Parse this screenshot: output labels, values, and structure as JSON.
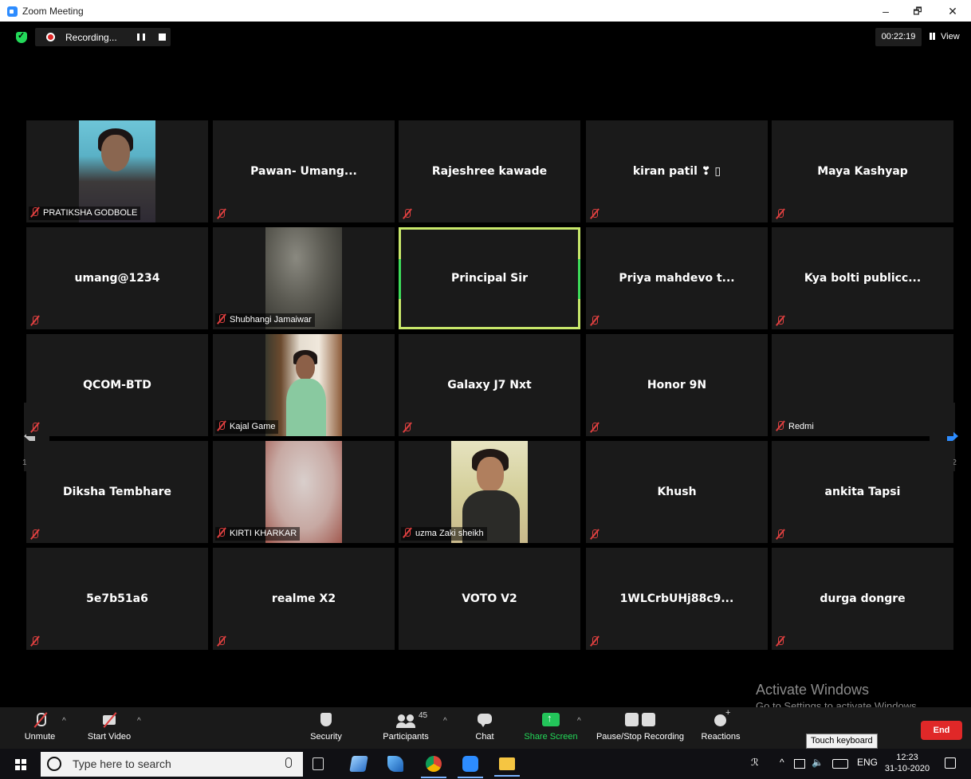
{
  "window": {
    "title": "Zoom Meeting",
    "minimize": "–",
    "restore": "🗗",
    "close": "✕"
  },
  "topbar": {
    "recording_label": "Recording...",
    "timer": "00:22:19",
    "view_label": "View"
  },
  "gallery": {
    "page_indicator_left": "1/2",
    "page_indicator_right": "1/2",
    "active_speaker": "Principal Sir",
    "tiles": [
      {
        "name": "PRATIKSHA GODBOLE",
        "video": true,
        "muted": true
      },
      {
        "name": "Pawan- Umang...",
        "video": false,
        "muted": true
      },
      {
        "name": "Rajeshree kawade",
        "video": false,
        "muted": true
      },
      {
        "name": "kiran patil ❣ ▯",
        "video": false,
        "muted": true
      },
      {
        "name": "Maya Kashyap",
        "video": false,
        "muted": true
      },
      {
        "name": "umang@1234",
        "video": false,
        "muted": true
      },
      {
        "name": "Shubhangi Jamaiwar",
        "video": true,
        "muted": true
      },
      {
        "name": "Principal Sir",
        "video": false,
        "muted": false
      },
      {
        "name": "Priya mahdevo t...",
        "video": false,
        "muted": true
      },
      {
        "name": "Kya bolti publicc...",
        "video": false,
        "muted": true
      },
      {
        "name": "QCOM-BTD",
        "video": false,
        "muted": true
      },
      {
        "name": "Kajal Game",
        "video": true,
        "muted": true
      },
      {
        "name": "Galaxy J7 Nxt",
        "video": false,
        "muted": true
      },
      {
        "name": "Honor 9N",
        "video": false,
        "muted": true
      },
      {
        "name": "Redmi",
        "video": false,
        "muted": true
      },
      {
        "name": "Diksha Tembhare",
        "video": false,
        "muted": true
      },
      {
        "name": "KIRTI KHARKAR",
        "video": true,
        "muted": true
      },
      {
        "name": "uzma Zaki sheikh",
        "video": true,
        "muted": true
      },
      {
        "name": "Khush",
        "video": false,
        "muted": true
      },
      {
        "name": "ankita Tapsi",
        "video": false,
        "muted": true
      },
      {
        "name": "5e7b51a6",
        "video": false,
        "muted": true
      },
      {
        "name": "realme X2",
        "video": false,
        "muted": true
      },
      {
        "name": "VOTO V2",
        "video": false,
        "muted": false
      },
      {
        "name": "1WLCrbUHj88c9...",
        "video": false,
        "muted": true
      },
      {
        "name": "durga dongre",
        "video": false,
        "muted": true
      }
    ]
  },
  "watermark": {
    "line1": "Activate Windows",
    "line2": "Go to Settings to activate Windows."
  },
  "toolbar": {
    "unmute": "Unmute",
    "start_video": "Start Video",
    "security": "Security",
    "participants": "Participants",
    "participant_count": "45",
    "chat": "Chat",
    "share_screen": "Share Screen",
    "pause_stop_recording": "Pause/Stop Recording",
    "reactions": "Reactions",
    "end": "End",
    "share_color": "#23c55a",
    "end_color": "#e02828"
  },
  "tooltip": "Touch keyboard",
  "taskbar": {
    "search_placeholder": "Type here to search",
    "language": "ENG",
    "time": "12:23",
    "date": "31-10-2020"
  }
}
